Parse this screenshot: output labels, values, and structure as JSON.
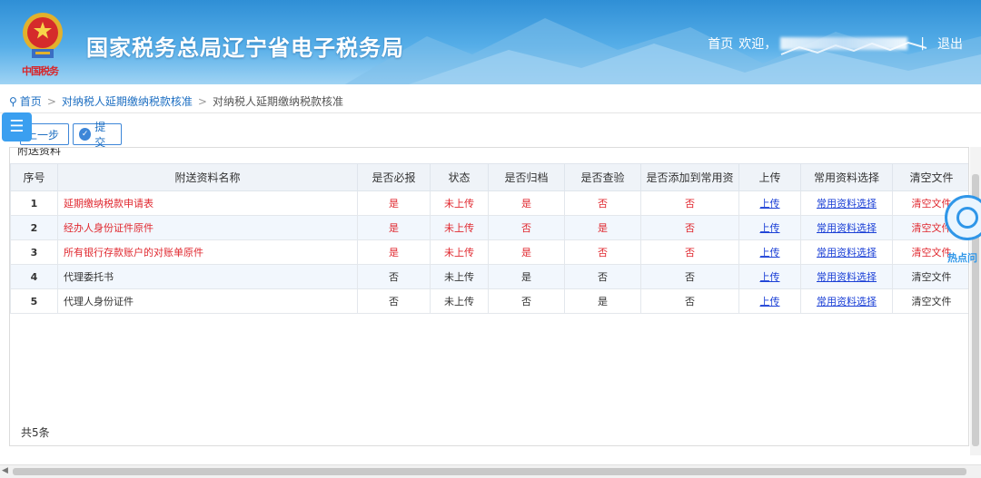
{
  "header": {
    "site_title": "国家税务总局辽宁省电子税务局",
    "emblem_caption": "中国税务",
    "nav_home": "首页",
    "welcome": "欢迎，",
    "separator": "|",
    "logout": "退出"
  },
  "breadcrumb": {
    "home": "首页",
    "arrow": ">",
    "level1": "对纳税人延期缴纳税款核准",
    "level2": "对纳税人延期缴纳税款核准"
  },
  "toolbar": {
    "menu_glyph": "☰",
    "prev_label": "上一步",
    "submit_label": "提交"
  },
  "panel": {
    "caption": "附送资料"
  },
  "table": {
    "headers": [
      "序号",
      "附送资料名称",
      "是否必报",
      "状态",
      "是否归档",
      "是否查验",
      "是否添加到常用资",
      "上传",
      "常用资料选择",
      "清空文件"
    ],
    "rows": [
      {
        "idx": "1",
        "name": "延期缴纳税款申请表",
        "required": "是",
        "status": "未上传",
        "archived": "是",
        "checked": "否",
        "common": "否",
        "upload": "上传",
        "select": "常用资料选择",
        "clear": "清空文件",
        "red": true
      },
      {
        "idx": "2",
        "name": "经办人身份证件原件",
        "required": "是",
        "status": "未上传",
        "archived": "否",
        "checked": "是",
        "common": "否",
        "upload": "上传",
        "select": "常用资料选择",
        "clear": "清空文件",
        "red": true
      },
      {
        "idx": "3",
        "name": "所有银行存款账户的对账单原件",
        "required": "是",
        "status": "未上传",
        "archived": "是",
        "checked": "否",
        "common": "否",
        "upload": "上传",
        "select": "常用资料选择",
        "clear": "清空文件",
        "red": true
      },
      {
        "idx": "4",
        "name": "代理委托书",
        "required": "否",
        "status": "未上传",
        "archived": "是",
        "checked": "否",
        "common": "否",
        "upload": "上传",
        "select": "常用资料选择",
        "clear": "清空文件",
        "red": false
      },
      {
        "idx": "5",
        "name": "代理人身份证件",
        "required": "否",
        "status": "未上传",
        "archived": "否",
        "checked": "是",
        "common": "否",
        "upload": "上传",
        "select": "常用资料选择",
        "clear": "清空文件",
        "red": false
      }
    ],
    "total": "共5条"
  },
  "hotspot": {
    "label": "热点问"
  },
  "colors": {
    "header_blue": "#2f8fd6",
    "link_blue": "#1e6fc2",
    "required_red": "#e0282f",
    "table_link": "#1a3fd6"
  }
}
